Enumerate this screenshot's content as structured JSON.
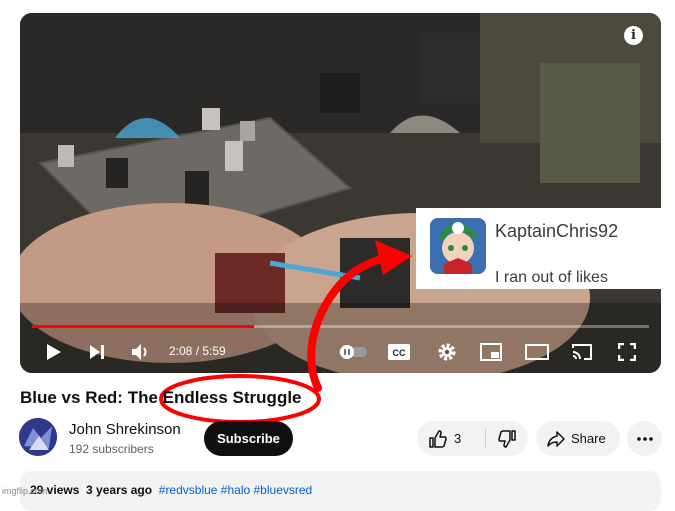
{
  "player": {
    "info_icon": "i",
    "time_display": "2:08 / 5:59",
    "progress_fraction": 0.36,
    "colors": {
      "progress": "#ff0000",
      "controls": "#ffffff"
    },
    "controls": [
      "play-icon",
      "next-icon",
      "volume-icon",
      "autoplay-toggle-icon",
      "captions-icon",
      "settings-gear-icon",
      "miniplayer-icon",
      "theater-icon",
      "cast-icon",
      "fullscreen-icon"
    ]
  },
  "comment_overlay": {
    "username": "KaptainChris92",
    "text": "I ran out of likes"
  },
  "annotation": {
    "color": "#ff0000"
  },
  "video": {
    "title": "Blue vs Red: The Endless Struggle"
  },
  "channel": {
    "name": "John Shrekinson",
    "subscribers": "192 subscribers",
    "subscribe_label": "Subscribe"
  },
  "actions": {
    "like_count": "3",
    "share_label": "Share"
  },
  "description": {
    "views": "29 views",
    "age": "3 years ago",
    "hashtags": "#redvsblue #halo #bluevsred"
  },
  "watermark": "imgflip.com"
}
